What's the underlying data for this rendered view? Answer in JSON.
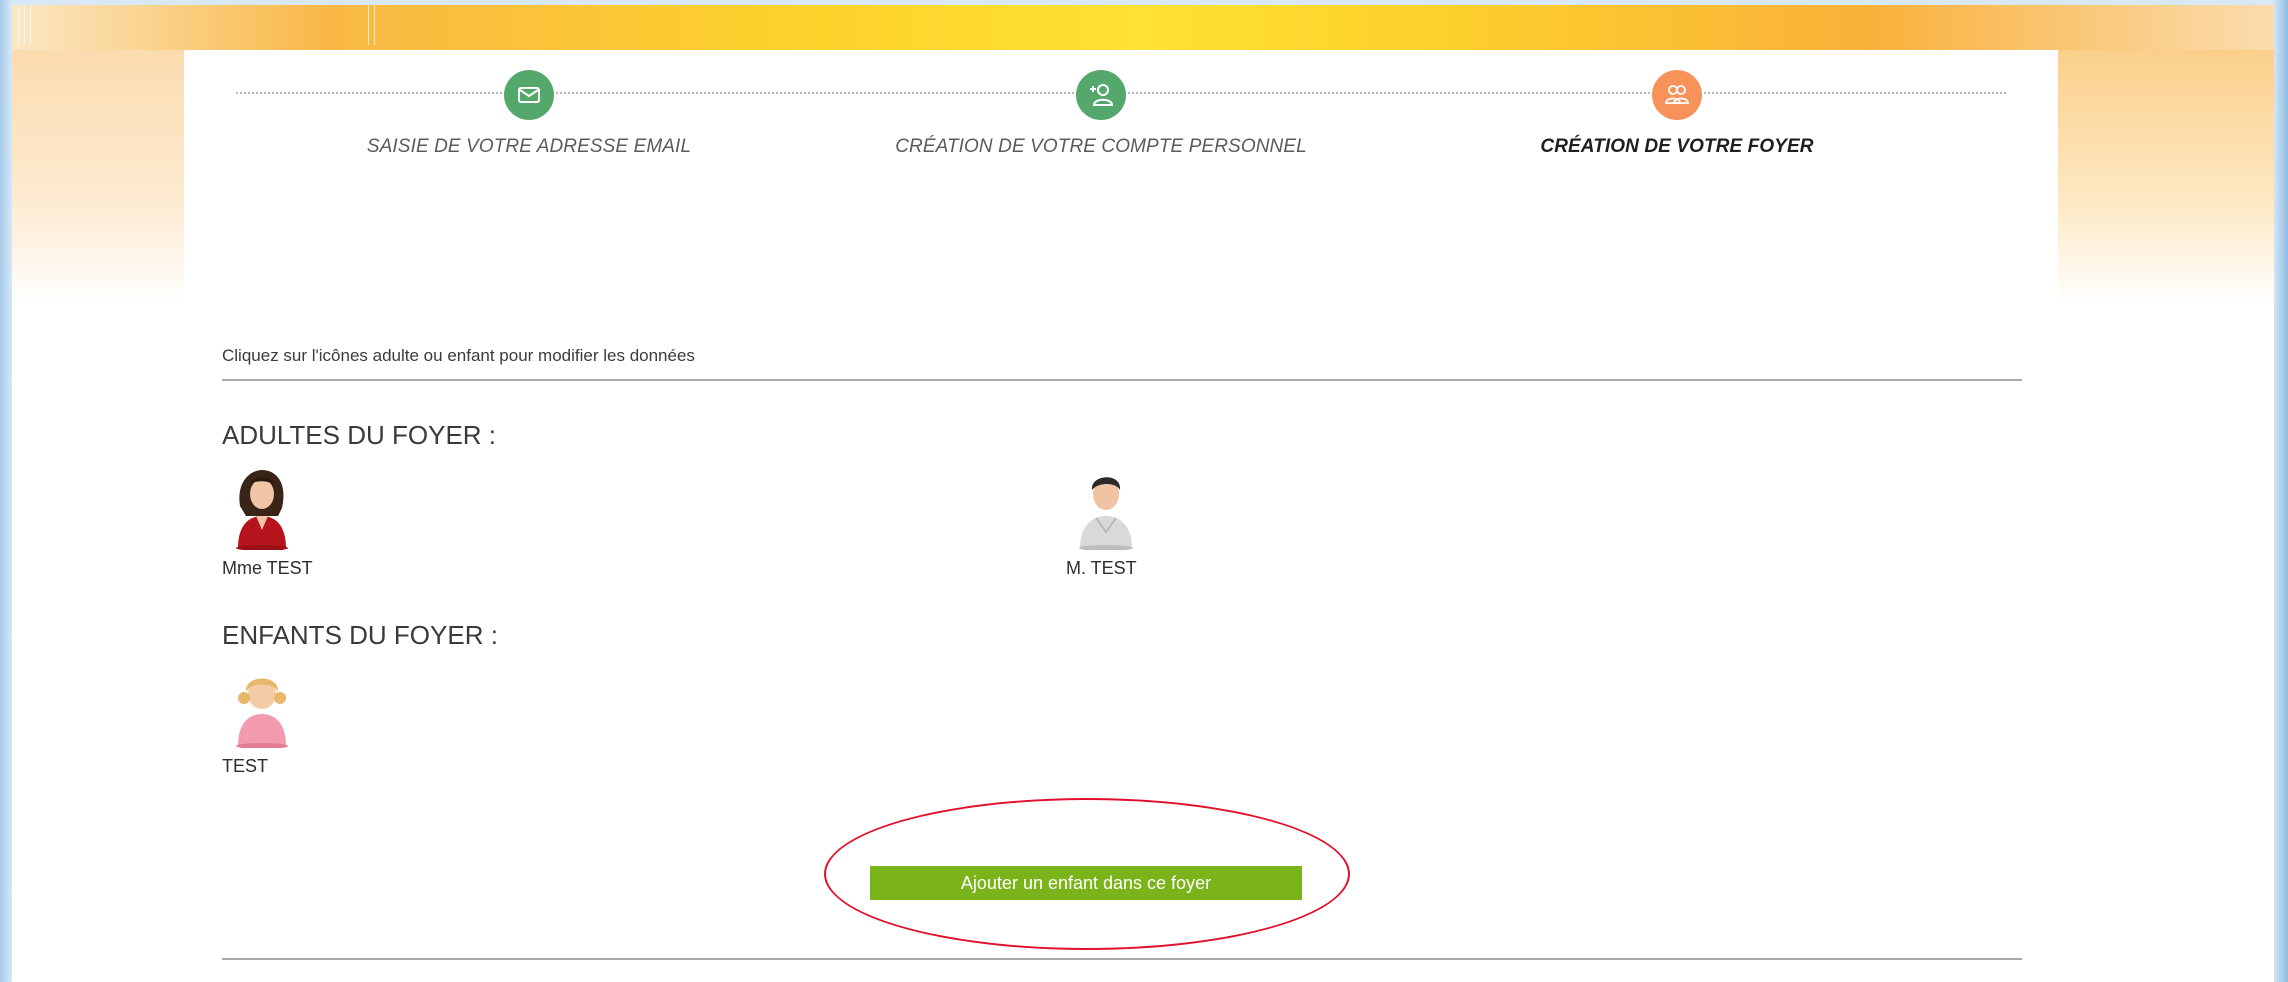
{
  "stepper": {
    "steps": [
      {
        "label": "SAISIE DE VOTRE ADRESSE EMAIL",
        "icon": "envelope-icon",
        "color": "#55a86c",
        "active": false
      },
      {
        "label": "CRÉATION DE VOTRE COMPTE PERSONNEL",
        "icon": "add-user-icon",
        "color": "#55a86c",
        "active": false
      },
      {
        "label": "CRÉATION DE VOTRE FOYER",
        "icon": "group-icon",
        "color": "#f7925a",
        "active": true
      }
    ]
  },
  "main": {
    "instruction": "Cliquez sur l'icônes adulte ou enfant pour modifier les données",
    "adults_title": "ADULTES DU FOYER :",
    "adults": [
      {
        "name": "Mme TEST",
        "icon": "woman-avatar-icon"
      },
      {
        "name": "M. TEST",
        "icon": "man-avatar-icon"
      }
    ],
    "children_title": "ENFANTS DU FOYER :",
    "children": [
      {
        "name": "TEST",
        "icon": "girl-avatar-icon"
      }
    ],
    "add_child_button": "Ajouter un enfant dans ce foyer"
  },
  "colors": {
    "accent_green": "#7bb31a",
    "step_done": "#55a86c",
    "step_active": "#f7925a",
    "highlight": "#e0102a"
  }
}
